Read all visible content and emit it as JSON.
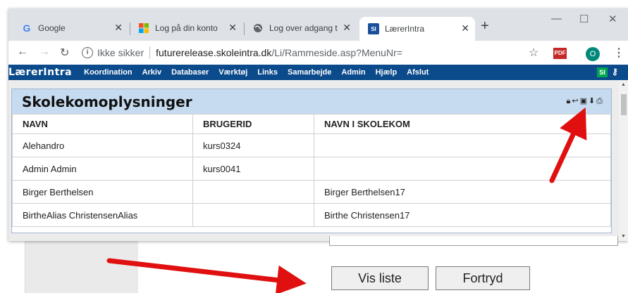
{
  "browser": {
    "tabs": [
      {
        "title": "Google",
        "favicon": "google-icon"
      },
      {
        "title": "Log på din konto",
        "favicon": "microsoft-icon"
      },
      {
        "title": "Log over adgang t",
        "favicon": "globe-icon"
      },
      {
        "title": "LærerIntra",
        "favicon": "si-icon",
        "active": true
      }
    ],
    "address": {
      "security": "Ikke sikker",
      "host": "futurerelease.skoleintra.dk",
      "path": "/Li/Rammeside.asp?MenuNr="
    },
    "pdf_label": "PDF",
    "profile_initial": "O"
  },
  "site": {
    "logo": "LærerIntra",
    "nav": [
      "Koordination",
      "Arkiv",
      "Databaser",
      "Værktøj",
      "Links",
      "Samarbejde",
      "Admin",
      "Hjælp",
      "Afslut"
    ],
    "si_badge": "SI"
  },
  "panel": {
    "title": "Skolekomoplysninger",
    "columns": [
      "NAVN",
      "BRUGERID",
      "NAVN I SKOLEKOM"
    ],
    "rows": [
      [
        "Alehandro",
        "kurs0324",
        ""
      ],
      [
        "Admin Admin",
        "kurs0041",
        ""
      ],
      [
        "Birger Berthelsen",
        "",
        "Birger Berthelsen17"
      ],
      [
        "BirtheAlias ChristensenAlias",
        "",
        "Birthe Christensen17"
      ]
    ]
  },
  "buttons": {
    "show_list": "Vis liste",
    "cancel": "Fortryd"
  },
  "colors": {
    "nav_bg": "#0b4a8b",
    "panel_header": "#c6dbf0",
    "arrow": "#e01010"
  }
}
